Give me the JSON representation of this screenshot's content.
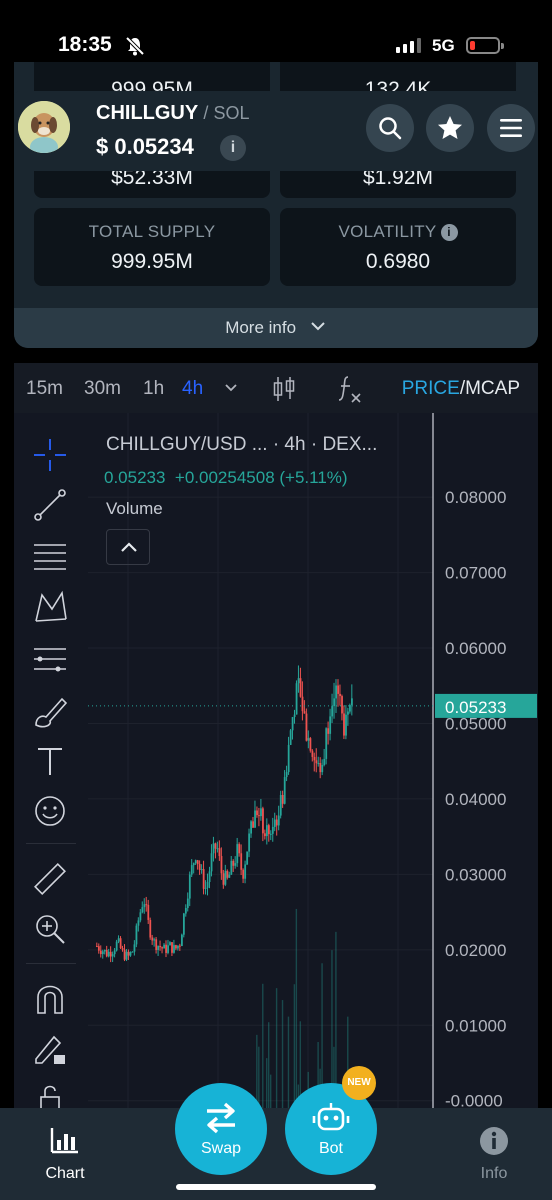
{
  "status": {
    "time": "18:35",
    "network": "5G"
  },
  "stats": [
    {
      "label": "",
      "value": "999.95M"
    },
    {
      "label": "",
      "value": "132.4K"
    },
    {
      "label": "",
      "value": "$52.33M"
    },
    {
      "label": "",
      "value": "$1.92M"
    },
    {
      "label": "TOTAL SUPPLY",
      "value": "999.95M"
    },
    {
      "label": "VOLATILITY",
      "value": "0.6980"
    }
  ],
  "more_info": "More info",
  "token": {
    "symbol": "CHILLGUY",
    "chain": "SOL",
    "price": "$ 0.05234"
  },
  "timeframes": [
    "15m",
    "30m",
    "1h",
    "4h"
  ],
  "active_timeframe": "4h",
  "price_toggle": {
    "price": "PRICE",
    "mcap": "MCAP"
  },
  "chart_legend": {
    "pair": "CHILLGUY/USD ... · 4h · DEX...",
    "last": "0.05233",
    "change": "+0.00254508 (+5.11%)",
    "volume": "Volume"
  },
  "chart_data": {
    "type": "candlestick",
    "pair": "CHILLGUY/USD",
    "interval": "4h",
    "y_ticks": [
      "0.08000",
      "0.07000",
      "0.06000",
      "0.05000",
      "0.04000",
      "0.03000",
      "0.02000",
      "0.01000",
      "-0.0000"
    ],
    "ylim": [
      -0.0003,
      0.0885
    ],
    "last_price_label": "0.05233",
    "last_price": 0.05233,
    "close_path": [
      0.0205,
      0.02,
      0.0195,
      0.02,
      0.021,
      0.0195,
      0.019,
      0.02,
      0.024,
      0.027,
      0.023,
      0.021,
      0.0205,
      0.02,
      0.0205,
      0.02,
      0.021,
      0.026,
      0.03,
      0.033,
      0.03,
      0.028,
      0.032,
      0.034,
      0.03,
      0.029,
      0.031,
      0.033,
      0.03,
      0.034,
      0.037,
      0.039,
      0.036,
      0.035,
      0.037,
      0.038,
      0.042,
      0.048,
      0.053,
      0.055,
      0.05,
      0.047,
      0.045,
      0.043,
      0.048,
      0.054,
      0.056,
      0.051,
      0.049,
      0.0523
    ]
  },
  "nav": {
    "chart": "Chart",
    "swap": "Swap",
    "bot": "Bot",
    "info": "Info",
    "new_badge": "NEW"
  },
  "colors": {
    "up": "#26a69a",
    "down": "#ef5350",
    "accent": "#17b3d6",
    "active_tf": "#2962ff"
  }
}
